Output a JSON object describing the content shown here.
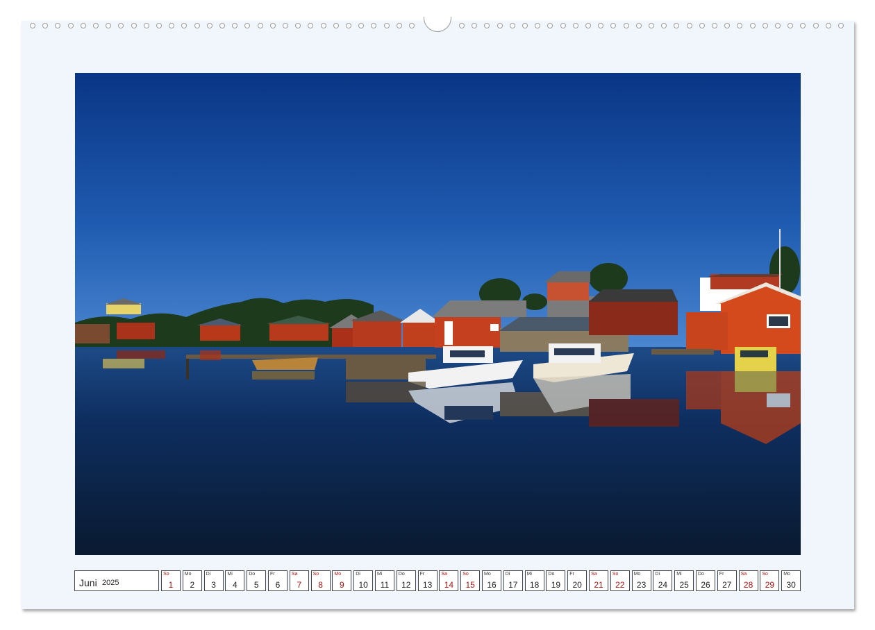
{
  "calendar": {
    "month": "Juni",
    "year": "2025",
    "weekend_color": "#b01010",
    "days": [
      {
        "abbr": "So",
        "num": "1",
        "weekend": true
      },
      {
        "abbr": "Mo",
        "num": "2",
        "weekend": false
      },
      {
        "abbr": "Di",
        "num": "3",
        "weekend": false
      },
      {
        "abbr": "Mi",
        "num": "4",
        "weekend": false
      },
      {
        "abbr": "Do",
        "num": "5",
        "weekend": false
      },
      {
        "abbr": "Fr",
        "num": "6",
        "weekend": false
      },
      {
        "abbr": "Sa",
        "num": "7",
        "weekend": true
      },
      {
        "abbr": "So",
        "num": "8",
        "weekend": true
      },
      {
        "abbr": "Mo",
        "num": "9",
        "weekend": true
      },
      {
        "abbr": "Di",
        "num": "10",
        "weekend": false
      },
      {
        "abbr": "Mi",
        "num": "11",
        "weekend": false
      },
      {
        "abbr": "Do",
        "num": "12",
        "weekend": false
      },
      {
        "abbr": "Fr",
        "num": "13",
        "weekend": false
      },
      {
        "abbr": "Sa",
        "num": "14",
        "weekend": true
      },
      {
        "abbr": "So",
        "num": "15",
        "weekend": true
      },
      {
        "abbr": "Mo",
        "num": "16",
        "weekend": false
      },
      {
        "abbr": "Di",
        "num": "17",
        "weekend": false
      },
      {
        "abbr": "Mi",
        "num": "18",
        "weekend": false
      },
      {
        "abbr": "Do",
        "num": "19",
        "weekend": false
      },
      {
        "abbr": "Fr",
        "num": "20",
        "weekend": false
      },
      {
        "abbr": "Sa",
        "num": "21",
        "weekend": true
      },
      {
        "abbr": "So",
        "num": "22",
        "weekend": true
      },
      {
        "abbr": "Mo",
        "num": "23",
        "weekend": false
      },
      {
        "abbr": "Di",
        "num": "24",
        "weekend": false
      },
      {
        "abbr": "Mi",
        "num": "25",
        "weekend": false
      },
      {
        "abbr": "Do",
        "num": "26",
        "weekend": false
      },
      {
        "abbr": "Fr",
        "num": "27",
        "weekend": false
      },
      {
        "abbr": "Sa",
        "num": "28",
        "weekend": true
      },
      {
        "abbr": "So",
        "num": "29",
        "weekend": true
      },
      {
        "abbr": "Mo",
        "num": "30",
        "weekend": false
      }
    ]
  },
  "photo": {
    "subject": "Red boathouses and moored boats reflected in calm harbour water under a clear blue sky",
    "sky_top_color": "#0a3a8c",
    "sky_bottom_color": "#3f7fcf",
    "water_color": "#0b1f45",
    "house_color": "#c4401e"
  }
}
